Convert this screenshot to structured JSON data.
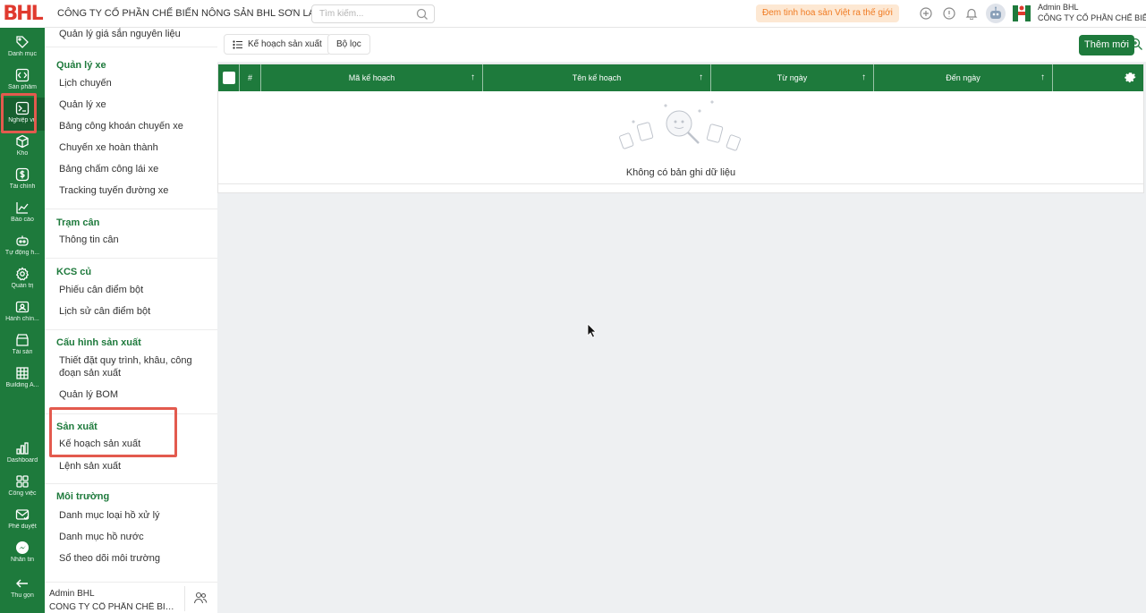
{
  "app": {
    "logo_text": "BHL",
    "company_title": "CÔNG TY CỔ PHẦN CHẾ BIẾN NÔNG SẢN BHL SƠN LA"
  },
  "search": {
    "placeholder": "Tìm kiếm..."
  },
  "slogan": "Đem tinh hoa sản Việt ra thế giới",
  "user": {
    "name": "Admin BHL",
    "company": "CÔNG TY CỔ PHẦN CHẾ BIẾN"
  },
  "rail": [
    {
      "label": "Danh mục",
      "icon": "tag-icon"
    },
    {
      "label": "Sản phẩm",
      "icon": "code-icon"
    },
    {
      "label": "Nghiệp vụ",
      "icon": "terminal-icon"
    },
    {
      "label": "Kho",
      "icon": "box-icon"
    },
    {
      "label": "Tài chính",
      "icon": "dollar-icon"
    },
    {
      "label": "Báo cáo",
      "icon": "chart-line-icon"
    },
    {
      "label": "Tự động h...",
      "icon": "robot-icon"
    },
    {
      "label": "Quản trị",
      "icon": "gear-icon"
    },
    {
      "label": "Hành chín...",
      "icon": "id-card-icon"
    },
    {
      "label": "Tài sản",
      "icon": "shop-icon"
    },
    {
      "label": "Building A...",
      "icon": "building-icon"
    },
    {
      "label": "Dashboard",
      "icon": "bar-chart-icon"
    },
    {
      "label": "Công việc",
      "icon": "grid-icon"
    },
    {
      "label": "Phê duyệt",
      "icon": "mail-check-icon"
    },
    {
      "label": "Nhắn tin",
      "icon": "messenger-icon"
    },
    {
      "label": "Thu gọn",
      "icon": "arrow-left-icon"
    }
  ],
  "submenu": {
    "top_item": "Quản lý giá sắn nguyên liệu",
    "sections": [
      {
        "title": "Quản lý xe",
        "items": [
          "Lịch chuyến",
          "Quản lý xe",
          "Bảng công khoán chuyến xe",
          "Chuyến xe hoàn thành",
          "Bảng chấm công lái xe",
          "Tracking tuyến đường xe"
        ]
      },
      {
        "title": "Trạm cân",
        "items": [
          "Thông tin cân"
        ]
      },
      {
        "title": "KCS củ",
        "items": [
          "Phiếu cân điểm bột",
          "Lịch sử cân điểm bột"
        ]
      },
      {
        "title": "Cấu hình sản xuất",
        "items": [
          "Thiết đặt quy trình, khâu, công đoạn sản xuất",
          "Quản lý BOM"
        ]
      },
      {
        "title": "Sản xuất",
        "items": [
          "Kế hoạch sản xuất",
          "Lệnh sản xuất"
        ]
      },
      {
        "title": "Môi trường",
        "items": [
          "Danh mục loại hồ xử lý",
          "Danh mục hồ nước",
          "Sổ theo dõi môi trường"
        ]
      }
    ]
  },
  "sidebar_footer": {
    "name": "Admin BHL",
    "company": "CÔNG TY CỔ PHẦN CHẾ BIẾN NÔNG SẢN BHL SƠN LA"
  },
  "toolbar": {
    "plan_label": "Kế hoạch sản xuất",
    "filter_label": "Bộ lọc",
    "add_label": "Thêm mới"
  },
  "table": {
    "columns": [
      "#",
      "Mã kế hoạch",
      "Tên kế hoạch",
      "Từ ngày",
      "Đến ngày"
    ],
    "empty_text": "Không có bản ghi dữ liệu"
  },
  "colors": {
    "primary": "#1e7a3c",
    "highlight": "#e35a4e",
    "slogan_bg": "#fde8d3",
    "slogan_text": "#f07b22"
  }
}
